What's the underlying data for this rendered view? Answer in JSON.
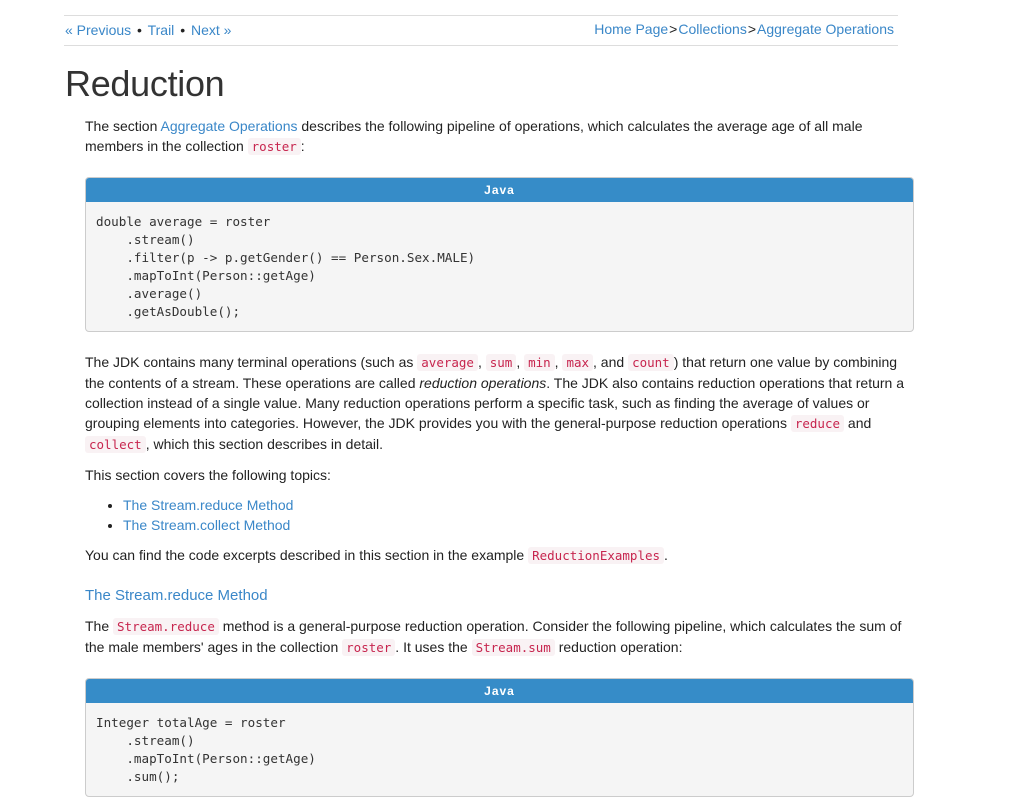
{
  "nav": {
    "previous": "« Previous",
    "trail": "Trail",
    "next": "Next »",
    "bullet": "•",
    "breadcrumb": [
      "Home Page",
      "Collections",
      "Aggregate Operations"
    ],
    "breadcrumb_sep": ">"
  },
  "page": {
    "title": "Reduction"
  },
  "intro": {
    "t1": "The section ",
    "link": "Aggregate Operations",
    "t2": " describes the following pipeline of operations, which calculates the average age of all male members in the collection ",
    "code": "roster",
    "t3": ":"
  },
  "code1": {
    "language": "Java",
    "source": "double average = roster\n    .stream()\n    .filter(p -> p.getGender() == Person.Sex.MALE)\n    .mapToInt(Person::getAge)\n    .average()\n    .getAsDouble();"
  },
  "para2": {
    "t1": "The JDK contains many terminal operations (such as ",
    "c1": "average",
    "s1": ", ",
    "c2": "sum",
    "s2": ", ",
    "c3": "min",
    "s3": ", ",
    "c4": "max",
    "s4": ", and ",
    "c5": "count",
    "t2": ") that return one value by combining the contents of a stream. These operations are called ",
    "em": "reduction operations",
    "t3": ". The JDK also contains reduction operations that return a collection instead of a single value. Many reduction operations perform a specific task, such as finding the average of values or grouping elements into categories. However, the JDK provides you with the general-purpose reduction operations ",
    "c6": "reduce",
    "t4": " and ",
    "c7": "collect",
    "t5": ", which this section describes in detail."
  },
  "topics": {
    "intro": "This section covers the following topics:",
    "items": [
      "The Stream.reduce Method",
      "The Stream.collect Method"
    ]
  },
  "excerpts": {
    "t1": "You can find the code excerpts described in this section in the example ",
    "code": "ReductionExamples",
    "t2": "."
  },
  "section_reduce": {
    "heading": "The Stream.reduce Method",
    "t1": "The ",
    "c1": "Stream.reduce",
    "t2": " method is a general-purpose reduction operation. Consider the following pipeline, which calculates the sum of the male members' ages in the collection ",
    "c2": "roster",
    "t3": ". It uses the ",
    "c3": "Stream.sum",
    "t4": " reduction operation:"
  },
  "code2": {
    "language": "Java",
    "source": "Integer totalAge = roster\n    .stream()\n    .mapToInt(Person::getAge)\n    .sum();"
  }
}
